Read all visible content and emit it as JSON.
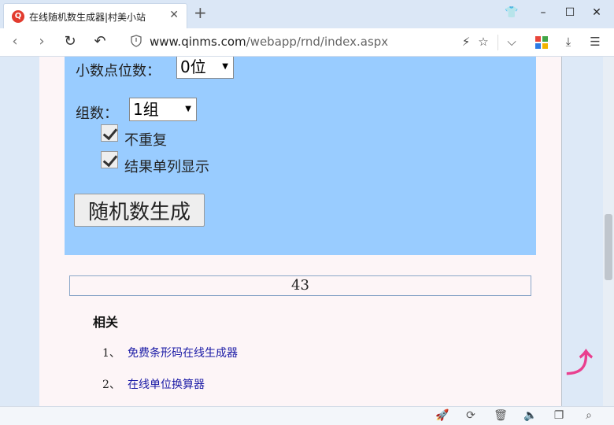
{
  "tab": {
    "favicon_text": "Q",
    "title": "在线随机数生成器|村美小站",
    "close": "✕",
    "new_tab": "+"
  },
  "window": {
    "shirt": "👕",
    "minimize": "–",
    "maximize": "☐",
    "close": "✕"
  },
  "address": {
    "back": "‹",
    "forward": "›",
    "reload": "↻",
    "undo": "↶",
    "url_host": "www.qinms.com",
    "url_path": "/webapp/rnd/index.aspx",
    "bolt": "⚡",
    "star": "☆",
    "chevron": "⌵",
    "download": "⤓",
    "menu": "☰"
  },
  "form": {
    "decimal_label": "小数点位数：",
    "decimal_value": "0位",
    "groups_label": "组数：",
    "groups_value": "1组",
    "no_repeat_label": "不重复",
    "single_column_label": "结果单列显示",
    "generate_button": "随机数生成"
  },
  "result": {
    "value": "43"
  },
  "related": {
    "title": "相关",
    "items": [
      {
        "num": "1、",
        "label": "免费条形码在线生成器"
      },
      {
        "num": "2、",
        "label": "在线单位换算器"
      }
    ]
  },
  "float": {
    "up": "⤴"
  },
  "status": {
    "rocket": "🚀",
    "refresh": "⟳",
    "trash": "🗑",
    "speaker": "🔈",
    "window": "❐",
    "search": "⌕"
  },
  "colors": {
    "panel": "#99ccff",
    "page": "#fdf5f7",
    "link": "#1a1aa6",
    "accent": "#e9408f"
  }
}
